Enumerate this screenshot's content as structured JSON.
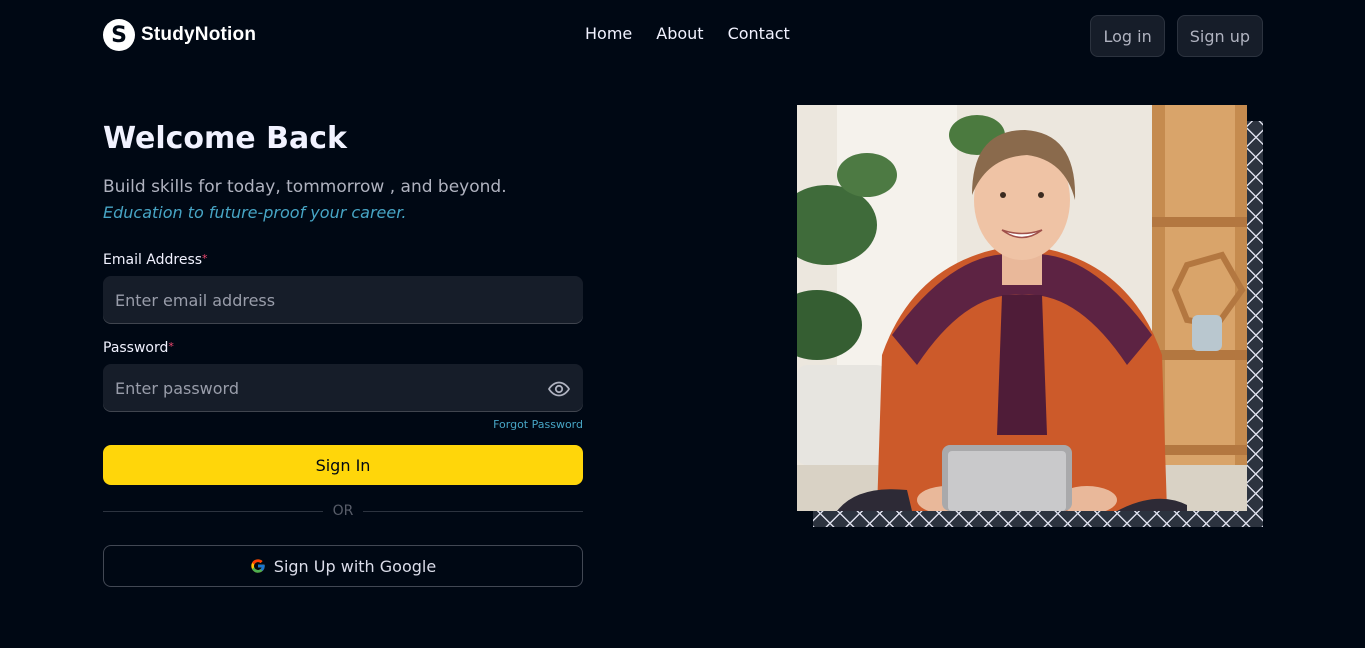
{
  "brand": {
    "name": "StudyNotion",
    "logo_letter": "S"
  },
  "nav": {
    "links": [
      "Home",
      "About",
      "Contact"
    ]
  },
  "auth": {
    "login": "Log in",
    "signup": "Sign up"
  },
  "form": {
    "title": "Welcome Back",
    "subtitle": "Build skills for today, tommorrow , and beyond.",
    "subtitle_highlight": "Education to future-proof your career.",
    "email_label": "Email Address",
    "email_placeholder": "Enter email address",
    "password_label": "Password",
    "password_placeholder": "Enter password",
    "required_mark": "*",
    "forgot": "Forgot Password",
    "submit": "Sign In",
    "divider": "OR",
    "google": "Sign Up with Google"
  },
  "icons": {
    "password_toggle": "eye-icon",
    "google": "google-icon"
  },
  "colors": {
    "background": "#000814",
    "accent": "#FFD60A",
    "highlight": "#47A5C5",
    "required": "#EF476F"
  }
}
